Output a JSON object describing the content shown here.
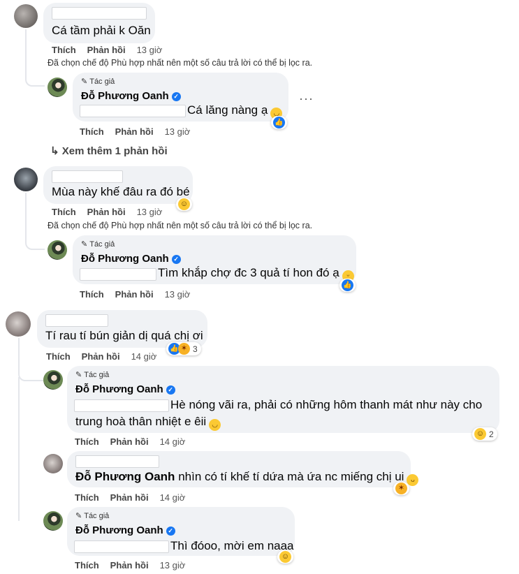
{
  "comments": [
    {
      "text": "Cá tầm phải k Oăn",
      "actions": {
        "like": "Thích",
        "reply": "Phản hồi",
        "time": "13 giờ"
      },
      "filter_note": "Đã chọn chế độ Phù hợp nhất nên một số câu trả lời có thể bị lọc ra.",
      "reply": {
        "author_badge": "Tác giả",
        "name": "Đỗ Phương Oanh",
        "text": "Cá lăng nàng ạ",
        "emoji": "smile",
        "reaction_icon": "like-icon",
        "actions": {
          "like": "Thích",
          "reply": "Phản hồi",
          "time": "13 giờ"
        }
      },
      "view_more": "Xem thêm 1 phản hồi"
    },
    {
      "text": "Mùa này khế đâu ra đó bé",
      "reaction_icon": "haha-icon",
      "actions": {
        "like": "Thích",
        "reply": "Phản hồi",
        "time": "13 giờ"
      },
      "filter_note": "Đã chọn chế độ Phù hợp nhất nên một số câu trả lời có thể bị lọc ra.",
      "reply": {
        "author_badge": "Tác giả",
        "name": "Đỗ Phương Oanh",
        "text": "Tìm khắp chợ đc 3 quả tí hon đó ạ",
        "emoji": "teary",
        "reaction_icon": "like-icon",
        "actions": {
          "like": "Thích",
          "reply": "Phản hồi",
          "time": "13 giờ"
        }
      }
    },
    {
      "text": "Tí rau tí bún giản dị quá chị ơi",
      "reaction_count": "3",
      "actions": {
        "like": "Thích",
        "reply": "Phản hồi",
        "time": "14 giờ"
      },
      "replies": [
        {
          "author_badge": "Tác giả",
          "name": "Đỗ Phương Oanh",
          "text_line1": "Hè nóng vãi ra, phải có những hôm thanh mát như này cho",
          "text_line2": "trung hoà thân nhiệt e êii",
          "reaction_count": "2",
          "actions": {
            "like": "Thích",
            "reply": "Phản hồi",
            "time": "14 giờ"
          }
        },
        {
          "mention": "Đỗ Phương Oanh",
          "text": "nhìn có tí khế tí dứa mà ứa nc miếng chị ui",
          "actions": {
            "like": "Thích",
            "reply": "Phản hồi",
            "time": "14 giờ"
          }
        },
        {
          "author_badge": "Tác giả",
          "name": "Đỗ Phương Oanh",
          "text": "Thì đóoo, mời em naaa",
          "actions": {
            "like": "Thích",
            "reply": "Phản hồi",
            "time": "13 giờ"
          }
        }
      ]
    }
  ],
  "colors": {
    "bubble": "#f0f2f5",
    "like_blue": "#1877f2",
    "haha_yellow": "#fbc933"
  }
}
